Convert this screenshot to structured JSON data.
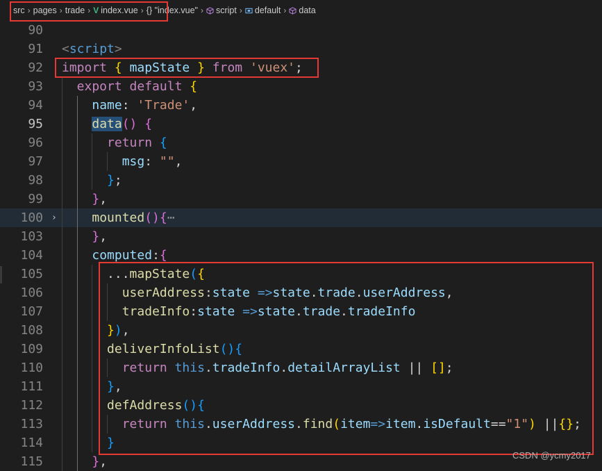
{
  "breadcrumb": {
    "items": [
      "src",
      "pages",
      "trade",
      "index.vue",
      "{} \"index.vue\"",
      "script",
      "default",
      "data"
    ],
    "icons": [
      "",
      "",
      "",
      "vue-icon",
      "braces-icon",
      "cube-icon",
      "object-icon",
      "cube-icon"
    ]
  },
  "colors": {
    "keyword": "#569cd6",
    "control": "#c586c0",
    "string": "#ce9178",
    "property": "#9cdcfe",
    "function": "#dcdcaa",
    "annotation": "#e53935"
  },
  "editor": {
    "lines": [
      {
        "num": "90",
        "indent": 0,
        "fold": false,
        "tokens": []
      },
      {
        "num": "91",
        "indent": 0,
        "tokens": [
          [
            "tag",
            "<"
          ],
          [
            "tagname",
            "script"
          ],
          [
            "tag",
            ">"
          ]
        ]
      },
      {
        "num": "92",
        "indent": 0,
        "tokens": [
          [
            "ctl",
            "import"
          ],
          [
            "plain",
            " "
          ],
          [
            "br1",
            "{"
          ],
          [
            "plain",
            " "
          ],
          [
            "var",
            "mapState"
          ],
          [
            "plain",
            " "
          ],
          [
            "br1",
            "}"
          ],
          [
            "plain",
            " "
          ],
          [
            "ctl",
            "from"
          ],
          [
            "plain",
            " "
          ],
          [
            "str",
            "'vuex'"
          ],
          [
            "plain",
            ";"
          ]
        ]
      },
      {
        "num": "93",
        "indent": 1,
        "tokens": [
          [
            "ctl",
            "export"
          ],
          [
            "plain",
            " "
          ],
          [
            "ctl",
            "default"
          ],
          [
            "plain",
            " "
          ],
          [
            "br1",
            "{"
          ]
        ]
      },
      {
        "num": "94",
        "indent": 2,
        "tokens": [
          [
            "prop",
            "name"
          ],
          [
            "plain",
            ": "
          ],
          [
            "str",
            "'Trade'"
          ],
          [
            "plain",
            ","
          ]
        ]
      },
      {
        "num": "95",
        "indent": 2,
        "active": true,
        "tokens": [
          [
            "fnhl",
            "data"
          ],
          [
            "br2",
            "()"
          ],
          [
            "plain",
            " "
          ],
          [
            "br2",
            "{"
          ]
        ]
      },
      {
        "num": "96",
        "indent": 3,
        "tokens": [
          [
            "ctl",
            "return"
          ],
          [
            "plain",
            " "
          ],
          [
            "br3",
            "{"
          ]
        ]
      },
      {
        "num": "97",
        "indent": 4,
        "tokens": [
          [
            "prop",
            "msg"
          ],
          [
            "plain",
            ": "
          ],
          [
            "str",
            "\"\""
          ],
          [
            "plain",
            ","
          ]
        ]
      },
      {
        "num": "98",
        "indent": 3,
        "tokens": [
          [
            "br3",
            "}"
          ],
          [
            "plain",
            ";"
          ]
        ]
      },
      {
        "num": "99",
        "indent": 2,
        "tokens": [
          [
            "br2",
            "}"
          ],
          [
            "plain",
            ","
          ]
        ]
      },
      {
        "num": "100",
        "indent": 2,
        "fold": true,
        "hl": true,
        "tokens": [
          [
            "fn",
            "mounted"
          ],
          [
            "br2",
            "()"
          ],
          [
            "br2",
            "{"
          ],
          [
            "ellipsis",
            "⋯"
          ]
        ]
      },
      {
        "num": "103",
        "indent": 2,
        "tokens": [
          [
            "br2",
            "}"
          ],
          [
            "plain",
            ","
          ]
        ]
      },
      {
        "num": "104",
        "indent": 2,
        "tokens": [
          [
            "prop",
            "computed"
          ],
          [
            "plain",
            ":"
          ],
          [
            "br2",
            "{"
          ]
        ]
      },
      {
        "num": "105",
        "indent": 3,
        "tokens": [
          [
            "plain",
            "..."
          ],
          [
            "fn",
            "mapState"
          ],
          [
            "br3",
            "("
          ],
          [
            "br1",
            "{"
          ]
        ]
      },
      {
        "num": "106",
        "indent": 4,
        "tokens": [
          [
            "fn",
            "userAddress"
          ],
          [
            "plain",
            ":"
          ],
          [
            "var",
            "state"
          ],
          [
            "plain",
            " "
          ],
          [
            "kw",
            "=>"
          ],
          [
            "var",
            "state"
          ],
          [
            "plain",
            "."
          ],
          [
            "prop",
            "trade"
          ],
          [
            "plain",
            "."
          ],
          [
            "prop",
            "userAddress"
          ],
          [
            "plain",
            ","
          ]
        ]
      },
      {
        "num": "107",
        "indent": 4,
        "tokens": [
          [
            "fn",
            "tradeInfo"
          ],
          [
            "plain",
            ":"
          ],
          [
            "var",
            "state"
          ],
          [
            "plain",
            " "
          ],
          [
            "kw",
            "=>"
          ],
          [
            "var",
            "state"
          ],
          [
            "plain",
            "."
          ],
          [
            "prop",
            "trade"
          ],
          [
            "plain",
            "."
          ],
          [
            "prop",
            "tradeInfo"
          ]
        ]
      },
      {
        "num": "108",
        "indent": 3,
        "tokens": [
          [
            "br1",
            "}"
          ],
          [
            "br3",
            ")"
          ],
          [
            "plain",
            ","
          ]
        ]
      },
      {
        "num": "109",
        "indent": 3,
        "tokens": [
          [
            "fn",
            "deliverInfoList"
          ],
          [
            "br3",
            "()"
          ],
          [
            "br3",
            "{"
          ]
        ]
      },
      {
        "num": "110",
        "indent": 4,
        "tokens": [
          [
            "ctl",
            "return"
          ],
          [
            "plain",
            " "
          ],
          [
            "kw",
            "this"
          ],
          [
            "plain",
            "."
          ],
          [
            "prop",
            "tradeInfo"
          ],
          [
            "plain",
            "."
          ],
          [
            "prop",
            "detailArrayList"
          ],
          [
            "plain",
            " || "
          ],
          [
            "br1",
            "[]"
          ],
          [
            "plain",
            ";"
          ]
        ]
      },
      {
        "num": "111",
        "indent": 3,
        "tokens": [
          [
            "br3",
            "}"
          ],
          [
            "plain",
            ","
          ]
        ]
      },
      {
        "num": "112",
        "indent": 3,
        "tokens": [
          [
            "fn",
            "defAddress"
          ],
          [
            "br3",
            "()"
          ],
          [
            "br3",
            "{"
          ]
        ]
      },
      {
        "num": "113",
        "indent": 4,
        "tokens": [
          [
            "ctl",
            "return"
          ],
          [
            "plain",
            " "
          ],
          [
            "kw",
            "this"
          ],
          [
            "plain",
            "."
          ],
          [
            "prop",
            "userAddress"
          ],
          [
            "plain",
            "."
          ],
          [
            "fn",
            "find"
          ],
          [
            "br1",
            "("
          ],
          [
            "var",
            "item"
          ],
          [
            "kw",
            "=>"
          ],
          [
            "var",
            "item"
          ],
          [
            "plain",
            "."
          ],
          [
            "prop",
            "isDefault"
          ],
          [
            "plain",
            "=="
          ],
          [
            "str",
            "\"1\""
          ],
          [
            "br1",
            ")"
          ],
          [
            "plain",
            " ||"
          ],
          [
            "br1",
            "{}"
          ],
          [
            "plain",
            ";"
          ]
        ]
      },
      {
        "num": "114",
        "indent": 3,
        "tokens": [
          [
            "br3",
            "}"
          ]
        ]
      },
      {
        "num": "115",
        "indent": 2,
        "tokens": [
          [
            "br2",
            "}"
          ],
          [
            "plain",
            ","
          ]
        ]
      }
    ]
  },
  "watermark": "CSDN @ycmy2017"
}
